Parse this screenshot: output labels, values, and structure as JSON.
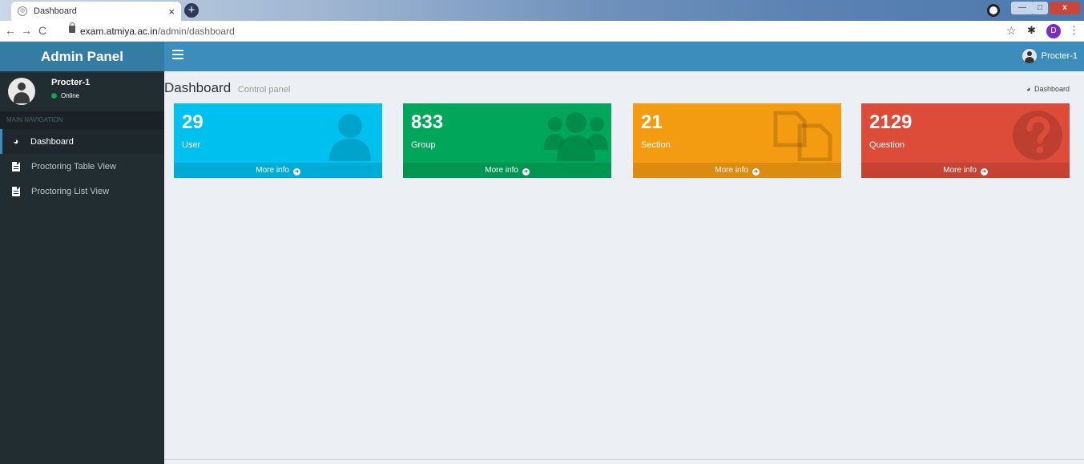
{
  "browser": {
    "tab_title": "Dashboard",
    "tab_close": "×",
    "new_tab": "+",
    "url_host": "exam.atmiya.ac.in",
    "url_path": "/admin/dashboard",
    "profile_initial": "D",
    "window_controls": {
      "minimize": "—",
      "maximize": "□",
      "close": "x"
    }
  },
  "app": {
    "logo": "Admin Panel",
    "header_user": "Procter-1"
  },
  "sidebar": {
    "user_name": "Procter-1",
    "user_status": "Online",
    "nav_header": "MAIN NAVIGATION",
    "items": [
      {
        "label": "Dashboard",
        "icon": "dashboard-icon",
        "active": true
      },
      {
        "label": "Proctoring Table View",
        "icon": "file-icon",
        "active": false
      },
      {
        "label": "Proctoring List View",
        "icon": "file-icon",
        "active": false
      }
    ]
  },
  "content": {
    "title": "Dashboard",
    "subtitle": "Control panel",
    "breadcrumb": "Dashboard",
    "boxes": [
      {
        "value": "29",
        "label": "User",
        "footer": "More info",
        "color": "#00c0ef",
        "icon": "user-icon"
      },
      {
        "value": "833",
        "label": "Group",
        "footer": "More info",
        "color": "#00a65a",
        "icon": "users-icon"
      },
      {
        "value": "21",
        "label": "Section",
        "footer": "More info",
        "color": "#f39c12",
        "icon": "copy-icon"
      },
      {
        "value": "2129",
        "label": "Question",
        "footer": "More info",
        "color": "#dd4b39",
        "icon": "question-icon"
      }
    ]
  }
}
